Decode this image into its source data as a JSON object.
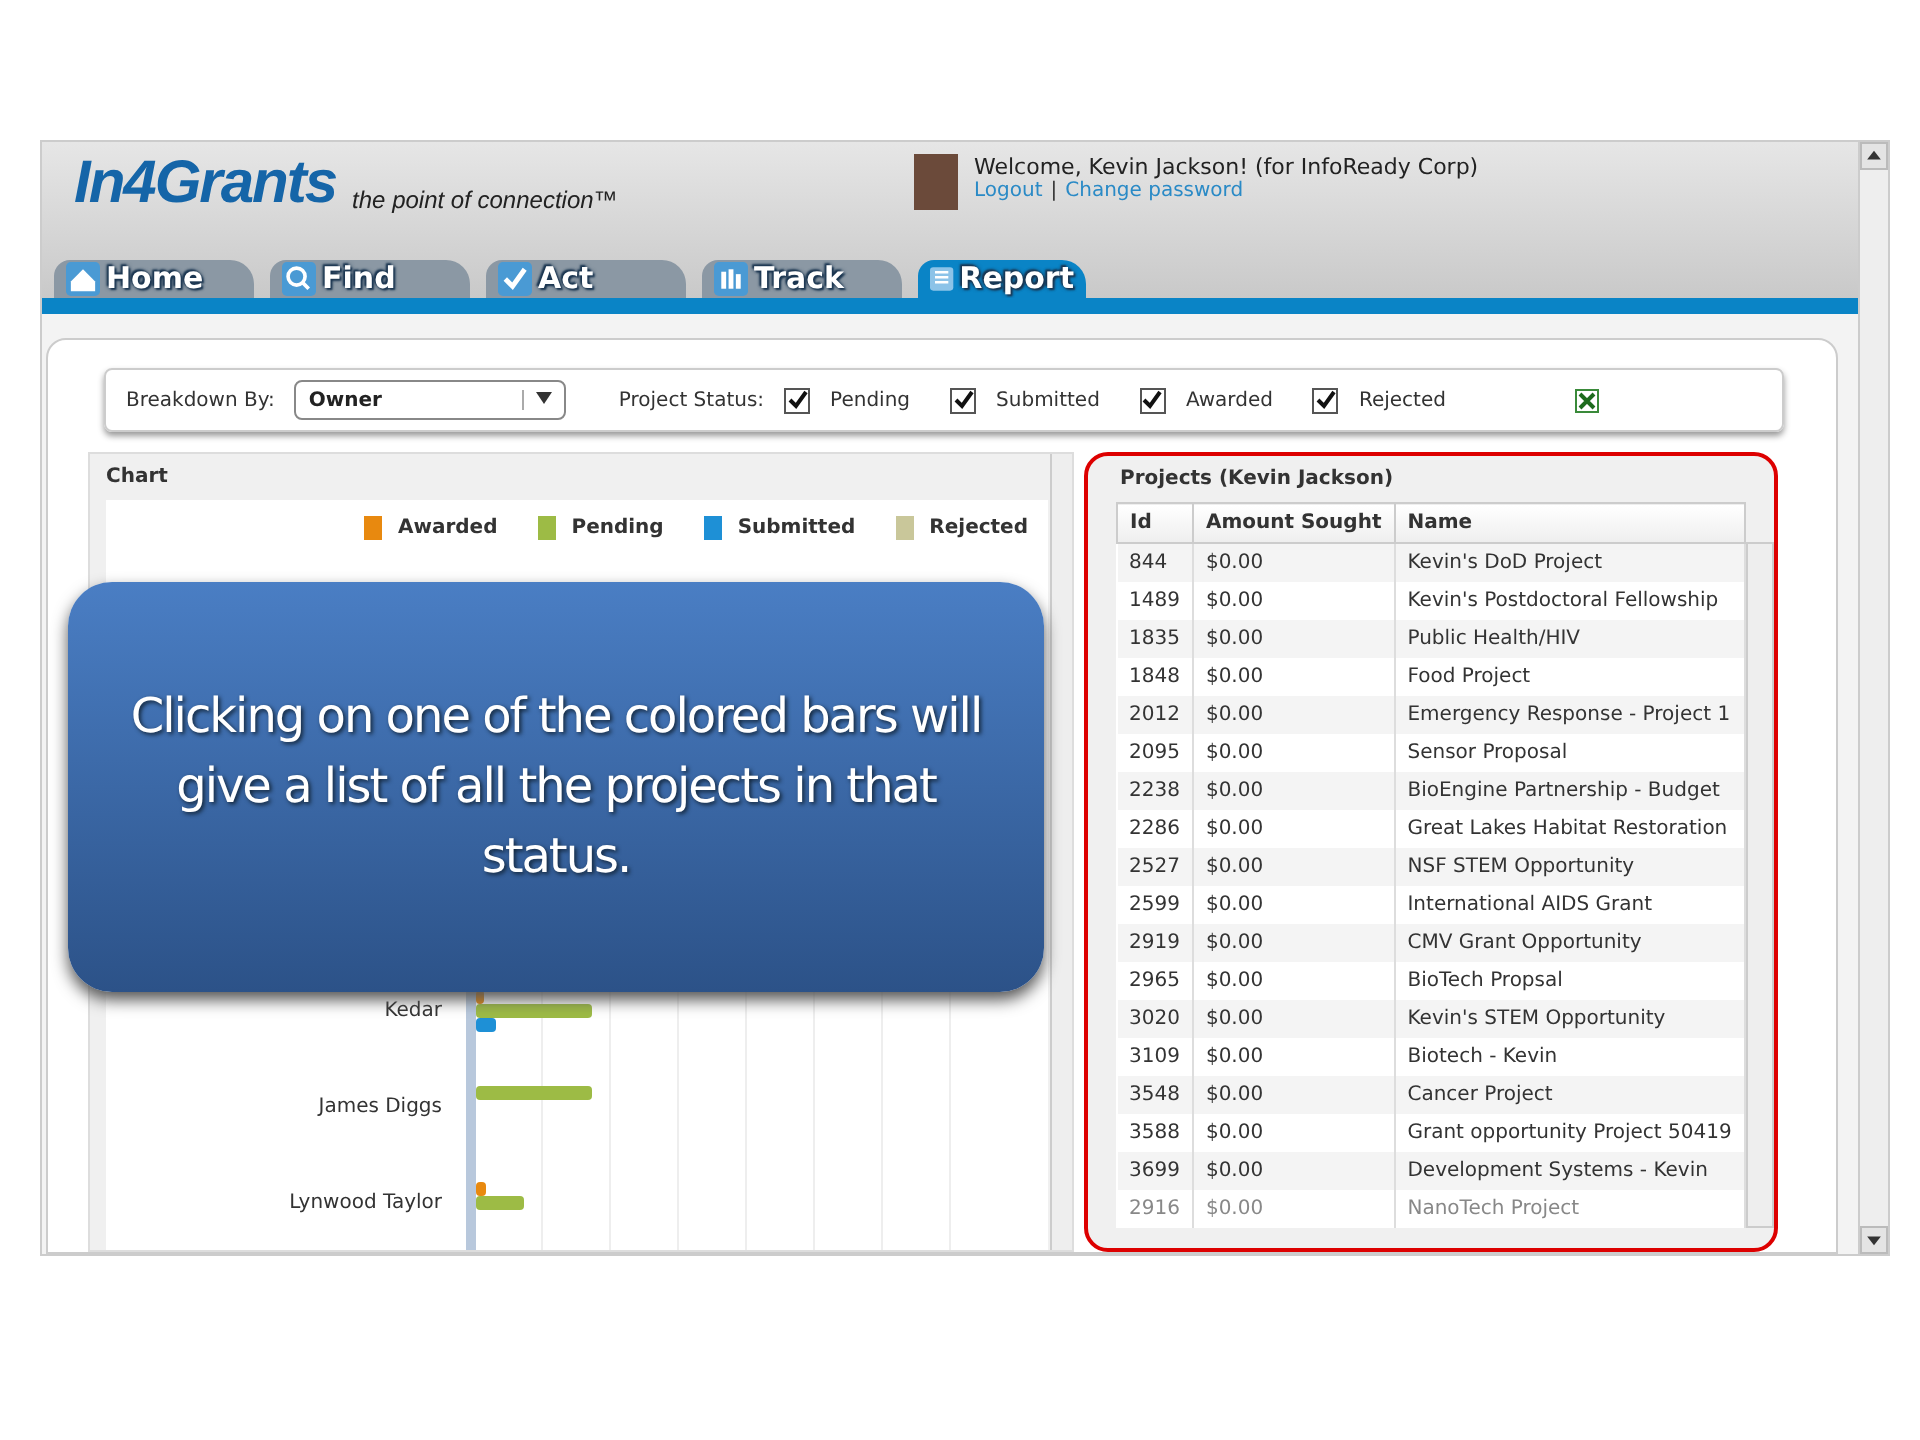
{
  "header": {
    "logo": "In4Grants",
    "tagline": "the point of connection™",
    "welcome": "Welcome, Kevin Jackson! (for InfoReady Corp)",
    "links": [
      "Logout",
      "Change password"
    ],
    "separator": "|"
  },
  "tabs": [
    {
      "label": "Home",
      "kind": "home",
      "selected": false
    },
    {
      "label": "Find",
      "kind": "find",
      "selected": false
    },
    {
      "label": "Act",
      "kind": "act",
      "selected": false
    },
    {
      "label": "Track",
      "kind": "track",
      "selected": false
    },
    {
      "label": "Report",
      "kind": "report",
      "selected": true
    }
  ],
  "filters": {
    "breakdown_label": "Breakdown By:",
    "breakdown_value": "Owner",
    "status_label": "Project Status:",
    "statuses": [
      {
        "label": "Pending",
        "checked": true
      },
      {
        "label": "Submitted",
        "checked": true
      },
      {
        "label": "Awarded",
        "checked": true
      },
      {
        "label": "Rejected",
        "checked": true
      }
    ]
  },
  "chart_panel": {
    "title": "Chart",
    "legend": [
      {
        "label": "Awarded",
        "color": "#e8890f"
      },
      {
        "label": "Pending",
        "color": "#9dbb45"
      },
      {
        "label": "Submitted",
        "color": "#1e90d6"
      },
      {
        "label": "Rejected",
        "color": "#c9c79a"
      }
    ],
    "owners": [
      "Kedar",
      "James Diggs",
      "Lynwood Taylor"
    ]
  },
  "projects": {
    "title": "Projects (Kevin Jackson)",
    "columns": [
      "Id",
      "Amount Sought",
      "Name"
    ],
    "rows": [
      [
        "844",
        "$0.00",
        "Kevin's DoD Project"
      ],
      [
        "1489",
        "$0.00",
        "Kevin's Postdoctoral Fellowship"
      ],
      [
        "1835",
        "$0.00",
        "Public Health/HIV"
      ],
      [
        "1848",
        "$0.00",
        "Food Project"
      ],
      [
        "2012",
        "$0.00",
        "Emergency Response - Project 1"
      ],
      [
        "2095",
        "$0.00",
        "Sensor Proposal"
      ],
      [
        "2238",
        "$0.00",
        "BioEngine Partnership - Budget"
      ],
      [
        "2286",
        "$0.00",
        "Great Lakes Habitat Restoration"
      ],
      [
        "2527",
        "$0.00",
        "NSF STEM Opportunity"
      ],
      [
        "2599",
        "$0.00",
        "International AIDS Grant"
      ],
      [
        "2919",
        "$0.00",
        "CMV Grant Opportunity"
      ],
      [
        "2965",
        "$0.00",
        "BioTech Propsal"
      ],
      [
        "3020",
        "$0.00",
        "Kevin's STEM Opportunity"
      ],
      [
        "3109",
        "$0.00",
        "Biotech - Kevin"
      ],
      [
        "3548",
        "$0.00",
        "Cancer Project"
      ],
      [
        "3588",
        "$0.00",
        "Grant opportunity Project 50419"
      ],
      [
        "3699",
        "$0.00",
        "Development Systems - Kevin"
      ],
      [
        "2916",
        "$0.00",
        "NanoTech Project"
      ]
    ]
  },
  "callout": "Clicking on one of the colored bars will give a list of all the projects in that status."
}
